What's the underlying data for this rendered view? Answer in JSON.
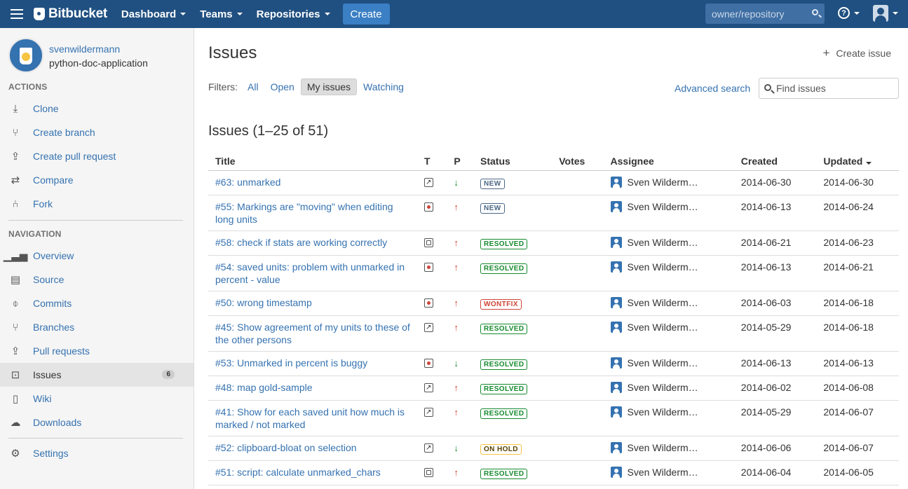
{
  "header": {
    "brand": "Bitbucket",
    "nav": [
      "Dashboard",
      "Teams",
      "Repositories"
    ],
    "create_label": "Create",
    "search_placeholder": "owner/repository",
    "help_icon": "question-icon",
    "user_icon": "user-icon"
  },
  "repo": {
    "owner": "svenwildermann",
    "name": "python-doc-application"
  },
  "sidebar": {
    "actions_heading": "ACTIONS",
    "actions": [
      {
        "label": "Clone",
        "icon": "download-icon"
      },
      {
        "label": "Create branch",
        "icon": "branch-icon"
      },
      {
        "label": "Create pull request",
        "icon": "pull-request-icon"
      },
      {
        "label": "Compare",
        "icon": "compare-icon"
      },
      {
        "label": "Fork",
        "icon": "fork-icon"
      }
    ],
    "navigation_heading": "NAVIGATION",
    "navigation": [
      {
        "label": "Overview",
        "icon": "overview-icon"
      },
      {
        "label": "Source",
        "icon": "source-icon"
      },
      {
        "label": "Commits",
        "icon": "commits-icon"
      },
      {
        "label": "Branches",
        "icon": "branches-icon"
      },
      {
        "label": "Pull requests",
        "icon": "pull-requests-icon"
      },
      {
        "label": "Issues",
        "icon": "issues-icon",
        "count": "6",
        "active": true
      },
      {
        "label": "Wiki",
        "icon": "wiki-icon"
      },
      {
        "label": "Downloads",
        "icon": "cloud-download-icon"
      }
    ],
    "settings": {
      "label": "Settings",
      "icon": "gear-icon"
    }
  },
  "main": {
    "title": "Issues",
    "create_issue": "Create issue",
    "filters_label": "Filters:",
    "filters": [
      "All",
      "Open",
      "My issues",
      "Watching"
    ],
    "selected_filter": "My issues",
    "advanced_search": "Advanced search",
    "find_placeholder": "Find issues",
    "list_title": "Issues (1–25 of 51)",
    "columns": [
      "Title",
      "T",
      "P",
      "Status",
      "Votes",
      "Assignee",
      "Created",
      "Updated"
    ],
    "sorted_column": "Updated",
    "issues": [
      {
        "title": "#63: unmarked",
        "type": "enhancement",
        "priority": "down",
        "status": "NEW",
        "votes": "",
        "assignee": "Sven Wilderm…",
        "created": "2014-06-30",
        "updated": "2014-06-30"
      },
      {
        "title": "#55: Markings are \"moving\" when editing long units",
        "type": "bug",
        "priority": "up",
        "status": "NEW",
        "votes": "",
        "assignee": "Sven Wilderm…",
        "created": "2014-06-13",
        "updated": "2014-06-24"
      },
      {
        "title": "#58: check if stats are working correctly",
        "type": "task",
        "priority": "up",
        "status": "RESOLVED",
        "votes": "",
        "assignee": "Sven Wilderm…",
        "created": "2014-06-21",
        "updated": "2014-06-23"
      },
      {
        "title": "#54: saved units: problem with unmarked in percent - value",
        "type": "bug",
        "priority": "up",
        "status": "RESOLVED",
        "votes": "",
        "assignee": "Sven Wilderm…",
        "created": "2014-06-13",
        "updated": "2014-06-21"
      },
      {
        "title": "#50: wrong timestamp",
        "type": "bug",
        "priority": "up",
        "status": "WONTFIX",
        "votes": "",
        "assignee": "Sven Wilderm…",
        "created": "2014-06-03",
        "updated": "2014-06-18"
      },
      {
        "title": "#45: Show agreement of my units to these of the other persons",
        "type": "enhancement",
        "priority": "up",
        "status": "RESOLVED",
        "votes": "",
        "assignee": "Sven Wilderm…",
        "created": "2014-05-29",
        "updated": "2014-06-18"
      },
      {
        "title": "#53: Unmarked in percent is buggy",
        "type": "bug",
        "priority": "down",
        "status": "RESOLVED",
        "votes": "",
        "assignee": "Sven Wilderm…",
        "created": "2014-06-13",
        "updated": "2014-06-13"
      },
      {
        "title": "#48: map gold-sample",
        "type": "enhancement",
        "priority": "up",
        "status": "RESOLVED",
        "votes": "",
        "assignee": "Sven Wilderm…",
        "created": "2014-06-02",
        "updated": "2014-06-08"
      },
      {
        "title": "#41: Show for each saved unit how much is marked / not marked",
        "type": "enhancement",
        "priority": "up",
        "status": "RESOLVED",
        "votes": "",
        "assignee": "Sven Wilderm…",
        "created": "2014-05-29",
        "updated": "2014-06-07"
      },
      {
        "title": "#52: clipboard-bloat on selection",
        "type": "enhancement",
        "priority": "down",
        "status": "ON HOLD",
        "votes": "",
        "assignee": "Sven Wilderm…",
        "created": "2014-06-06",
        "updated": "2014-06-07"
      },
      {
        "title": "#51: script: calculate unmarked_chars",
        "type": "task",
        "priority": "up",
        "status": "RESOLVED",
        "votes": "",
        "assignee": "Sven Wilderm…",
        "created": "2014-06-04",
        "updated": "2014-06-05"
      }
    ]
  },
  "colors": {
    "header_bg": "#205081",
    "link": "#3572b0",
    "resolved": "#14892c",
    "wontfix": "#d04437",
    "new": "#4a6785",
    "on_hold": "#f6c342"
  }
}
